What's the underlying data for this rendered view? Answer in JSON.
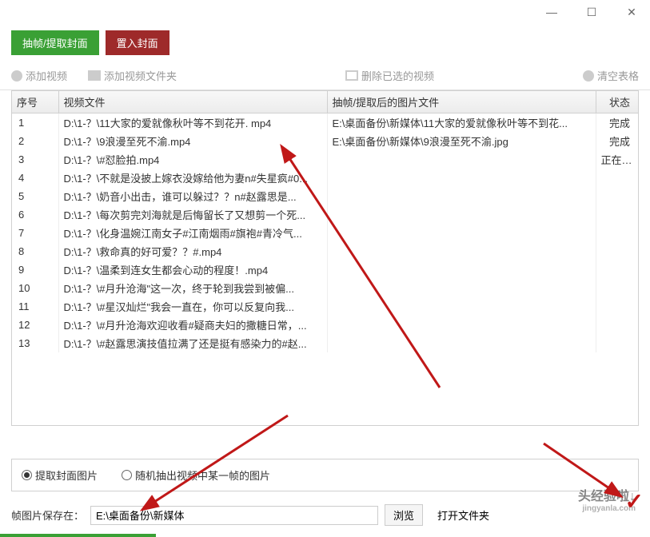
{
  "window": {
    "min": "—",
    "max": "☐",
    "close": "✕"
  },
  "tabs": {
    "extract": "抽帧/提取封面",
    "insert": "置入封面"
  },
  "toolbar": {
    "add_video": "添加视频",
    "add_folder": "添加视频文件夹",
    "delete_selected": "删除已选的视频",
    "clear_table": "清空表格"
  },
  "table": {
    "headers": {
      "num": "序号",
      "file": "视频文件",
      "output": "抽帧/提取后的图片文件",
      "status": "状态"
    },
    "rows": [
      {
        "num": "1",
        "file": "D:\\1-？\\11大家的爱就像秋叶等不到花开. mp4",
        "output": "E:\\桌面备份\\新媒体\\11大家的爱就像秋叶等不到花...",
        "status": "完成"
      },
      {
        "num": "2",
        "file": "D:\\1-？\\9浪漫至死不渝.mp4",
        "output": "E:\\桌面备份\\新媒体\\9浪漫至死不渝.jpg",
        "status": "完成"
      },
      {
        "num": "3",
        "file": "D:\\1-？\\#怼脸拍.mp4",
        "output": "",
        "status": "正在提取"
      },
      {
        "num": "4",
        "file": "D:\\1-？\\不就是没披上嫁衣没嫁给他为妻n#失星疯#0...",
        "output": "",
        "status": ""
      },
      {
        "num": "5",
        "file": "D:\\1-？\\奶音小出击，谁可以躲过？？n#赵露思是...",
        "output": "",
        "status": ""
      },
      {
        "num": "6",
        "file": "D:\\1-？\\每次剪完刘海就是后悔留长了又想剪一个死...",
        "output": "",
        "status": ""
      },
      {
        "num": "7",
        "file": "D:\\1-？\\化身温婉江南女子#江南烟雨#旗袍#青冷气...",
        "output": "",
        "status": ""
      },
      {
        "num": "8",
        "file": "D:\\1-？\\救命真的好可爱？？#.mp4",
        "output": "",
        "status": ""
      },
      {
        "num": "9",
        "file": "D:\\1-？\\温柔到连女生都会心动的程度！.mp4",
        "output": "",
        "status": ""
      },
      {
        "num": "10",
        "file": "D:\\1-？\\#月升沧海\"这一次，终于轮到我尝到被偏...",
        "output": "",
        "status": ""
      },
      {
        "num": "11",
        "file": "D:\\1-？\\#星汉灿烂\"我会一直在，你可以反复向我...",
        "output": "",
        "status": ""
      },
      {
        "num": "12",
        "file": "D:\\1-？\\#月升沧海欢迎收看#疑商夫妇的撒糖日常，...",
        "output": "",
        "status": ""
      },
      {
        "num": "13",
        "file": "D:\\1-？\\#赵露思演技值拉满了还是挺有感染力的#赵...",
        "output": "",
        "status": ""
      }
    ]
  },
  "options": {
    "opt1": "提取封面图片",
    "opt2": "随机抽出视频中某一帧的图片"
  },
  "save": {
    "label": "帧图片保存在：",
    "path": "E:\\桌面备份\\新媒体",
    "browse": "浏览",
    "open_folder": "打开文件夹"
  },
  "watermark": {
    "main": "头经验啦↓",
    "sub": "jingyanla.com"
  },
  "colors": {
    "green": "#3aa035",
    "red": "#9e2a2a",
    "arrow": "#c01818"
  }
}
